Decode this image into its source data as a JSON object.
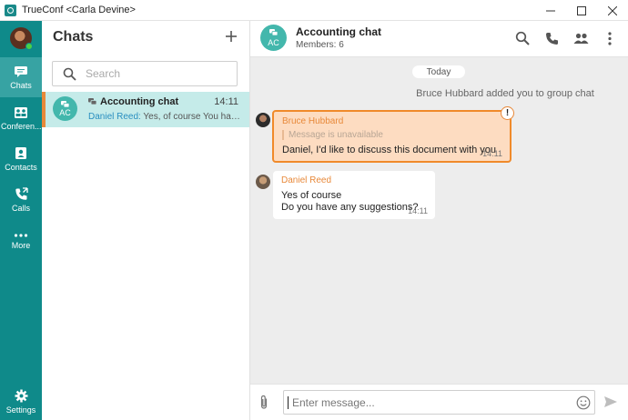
{
  "window": {
    "title": "TrueConf <Carla Devine>"
  },
  "nav": {
    "items": [
      {
        "label": "Chats",
        "icon": "chat-icon"
      },
      {
        "label": "Conferen...",
        "icon": "conference-icon"
      },
      {
        "label": "Contacts",
        "icon": "contacts-icon"
      },
      {
        "label": "Calls",
        "icon": "calls-icon"
      },
      {
        "label": "More",
        "icon": "more-icon"
      }
    ],
    "settings_label": "Settings"
  },
  "chat_list": {
    "title": "Chats",
    "search_placeholder": "Search",
    "items": [
      {
        "avatar_initials": "AC",
        "title": "Accounting chat",
        "time": "14:11",
        "sender": "Daniel Reed:",
        "preview": "Yes, of course You have a..."
      }
    ]
  },
  "chat": {
    "avatar_initials": "AC",
    "title": "Accounting chat",
    "members": "Members: 6",
    "day_label": "Today",
    "system_message": "Bruce Hubbard added you to group chat",
    "messages": [
      {
        "sender": "Bruce Hubbard",
        "quote": "Message is unavailable",
        "text": "Daniel, I'd like to discuss this document with you",
        "time": "14:11",
        "badge": "!"
      },
      {
        "sender": "Daniel Reed",
        "line1": "Yes of course",
        "line2": "Do you have any suggestions?",
        "time": "14:11"
      }
    ]
  },
  "composer": {
    "placeholder": "Enter message..."
  },
  "colors": {
    "accent": "#0f8a8a",
    "highlight": "#e8893a",
    "selected_row": "#c5ebe9",
    "warning_bubble": "#fddcc1"
  }
}
